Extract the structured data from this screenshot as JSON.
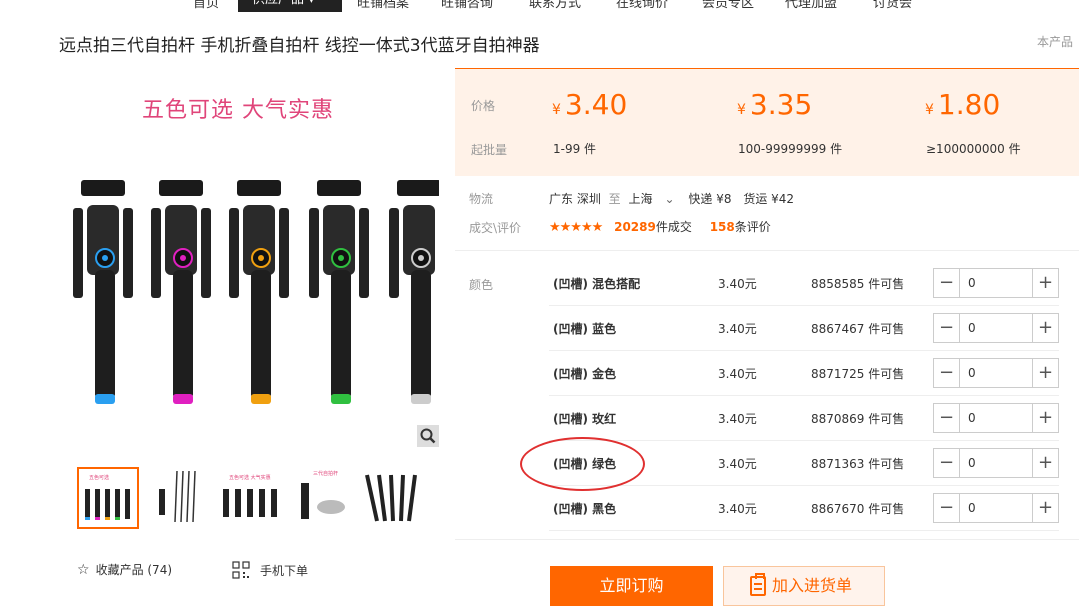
{
  "nav": {
    "items": [
      "首页",
      "供应产品",
      "旺铺档案",
      "旺铺咨询",
      "联系方式",
      "在线询价",
      "会员专区",
      "代理加盟",
      "讨货会"
    ],
    "active": "供应产品 ▾"
  },
  "product": {
    "title": "远点拍三代自拍杆 手机折叠自拍杆 线控一体式3代蓝牙自拍神器",
    "corner_text": "本产品",
    "slogan": "五色可选  大气实惠"
  },
  "pricing": {
    "price_label": "价格",
    "moq_label": "起批量",
    "currency": "¥",
    "tiers": [
      {
        "price": "3.40",
        "range": "1-99 件"
      },
      {
        "price": "3.35",
        "range": "100-99999999 件"
      },
      {
        "price": "1.80",
        "range": "≥100000000 件"
      }
    ]
  },
  "logistics": {
    "label": "物流",
    "from": "广东 深圳",
    "to_sep": "至",
    "to": "上海",
    "express": "快递 ¥8",
    "freight": "货运 ¥42"
  },
  "deals": {
    "label": "成交\\评价",
    "rating": 4.5,
    "stars": "★★★★★",
    "count": "20289",
    "count_suffix": "件成交",
    "reviews": "158",
    "reviews_suffix": "条评价"
  },
  "color_label": "颜色",
  "skus": [
    {
      "name": "(凹槽) 混色搭配",
      "price": "3.40元",
      "stock": "8858585 件可售",
      "qty": "0"
    },
    {
      "name": "(凹槽) 蓝色",
      "price": "3.40元",
      "stock": "8867467 件可售",
      "qty": "0"
    },
    {
      "name": "(凹槽) 金色",
      "price": "3.40元",
      "stock": "8871725 件可售",
      "qty": "0"
    },
    {
      "name": "(凹槽) 玫红",
      "price": "3.40元",
      "stock": "8870869 件可售",
      "qty": "0"
    },
    {
      "name": "(凹槽) 绿色",
      "price": "3.40元",
      "stock": "8871363 件可售",
      "qty": "0"
    },
    {
      "name": "(凹槽) 黑色",
      "price": "3.40元",
      "stock": "8867670 件可售",
      "qty": "0"
    }
  ],
  "actions": {
    "favorite": "收藏产品 (74)",
    "mobile_order": "手机下单",
    "buy_now": "立即订购",
    "add_to_cart": "加入进货单"
  },
  "colors": {
    "accent": "#ff6600",
    "stick_accents": [
      "#2a9ff0",
      "#e020c0",
      "#f0a010",
      "#30c040",
      "#cccccc"
    ]
  }
}
